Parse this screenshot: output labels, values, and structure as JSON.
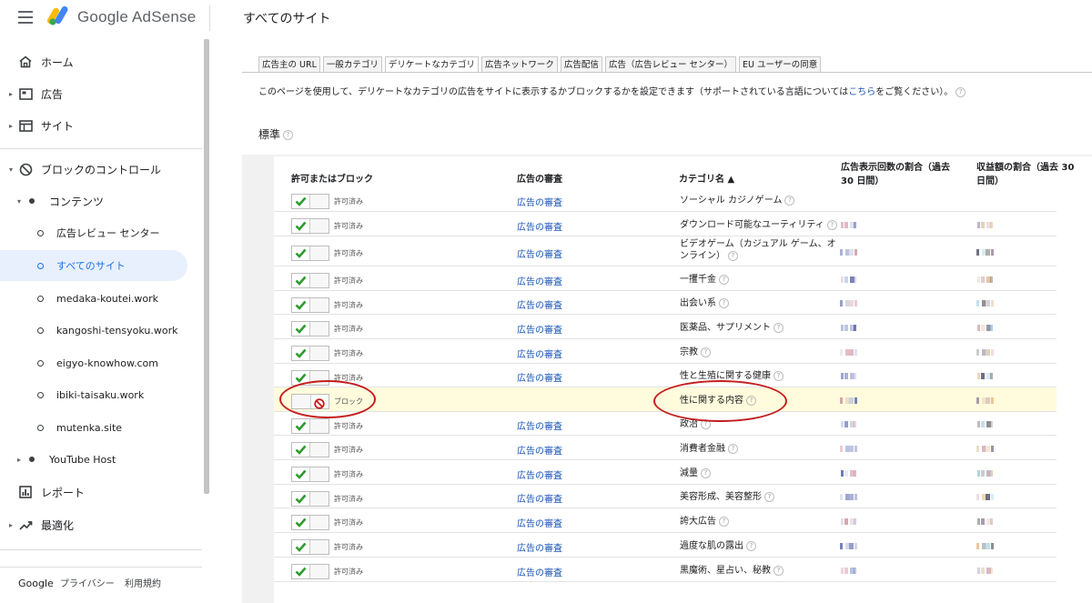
{
  "header": {
    "logo_text": "Google AdSense",
    "page_title": "すべてのサイト"
  },
  "sidebar": {
    "items": [
      {
        "label": "ホーム"
      },
      {
        "label": "広告"
      },
      {
        "label": "サイト"
      },
      {
        "label": "ブロックのコントロール"
      },
      {
        "label": "コンテンツ"
      },
      {
        "label": "広告レビュー センター"
      },
      {
        "label": "すべてのサイト"
      },
      {
        "label": "medaka-koutei.work"
      },
      {
        "label": "kangoshi-tensyoku.work"
      },
      {
        "label": "eigyo-knowhow.com"
      },
      {
        "label": "ibiki-taisaku.work"
      },
      {
        "label": "mutenka.site"
      },
      {
        "label": "YouTube Host"
      },
      {
        "label": "レポート"
      },
      {
        "label": "最適化"
      }
    ],
    "footer": {
      "google": "Google",
      "privacy": "プライバシー",
      "terms": "利用規約"
    }
  },
  "tabs": [
    "広告主の URL",
    "一般カテゴリ",
    "デリケートなカテゴリ",
    "広告ネットワーク",
    "広告配信",
    "広告（広告レビュー センター）",
    "EU ユーザーの同意"
  ],
  "description": {
    "before": "このページを使用して、デリケートなカテゴリの広告をサイトに表示するかブロックするかを設定できます（サポートされている言語については",
    "link": "こちら",
    "after": "をご覧ください）。"
  },
  "section_title": "標準",
  "help_glyph": "?",
  "table": {
    "headers": {
      "allow_block": "許可またはブロック",
      "review": "広告の審査",
      "category": "カテゴリ名 ▲",
      "impressions": "広告表示回数の割合（過去 30 日間）",
      "earnings": "収益額の割合（過去 30 日間）"
    },
    "rows": [
      {
        "state": "許可済み",
        "blocked": false,
        "review": "広告の審査",
        "category": "ソーシャル カジノゲーム"
      },
      {
        "state": "許可済み",
        "blocked": false,
        "review": "広告の審査",
        "category": "ダウンロード可能なユーティリティ"
      },
      {
        "state": "許可済み",
        "blocked": false,
        "review": "広告の審査",
        "category": "ビデオゲーム（カジュアル ゲーム、オンライン）"
      },
      {
        "state": "許可済み",
        "blocked": false,
        "review": "広告の審査",
        "category": "一攫千金"
      },
      {
        "state": "許可済み",
        "blocked": false,
        "review": "広告の審査",
        "category": "出会い系"
      },
      {
        "state": "許可済み",
        "blocked": false,
        "review": "広告の審査",
        "category": "医薬品、サプリメント"
      },
      {
        "state": "許可済み",
        "blocked": false,
        "review": "広告の審査",
        "category": "宗教"
      },
      {
        "state": "許可済み",
        "blocked": false,
        "review": "広告の審査",
        "category": "性と生殖に関する健康"
      },
      {
        "state": "ブロック",
        "blocked": true,
        "review": "",
        "category": "性に関する内容"
      },
      {
        "state": "許可済み",
        "blocked": false,
        "review": "広告の審査",
        "category": "政治"
      },
      {
        "state": "許可済み",
        "blocked": false,
        "review": "広告の審査",
        "category": "消費者金融"
      },
      {
        "state": "許可済み",
        "blocked": false,
        "review": "広告の審査",
        "category": "減量"
      },
      {
        "state": "許可済み",
        "blocked": false,
        "review": "広告の審査",
        "category": "美容形成、美容整形"
      },
      {
        "state": "許可済み",
        "blocked": false,
        "review": "広告の審査",
        "category": "誇大広告"
      },
      {
        "state": "許可済み",
        "blocked": false,
        "review": "広告の審査",
        "category": "過度な肌の露出"
      },
      {
        "state": "許可済み",
        "blocked": false,
        "review": "広告の審査",
        "category": "黒魔術、星占い、秘教"
      }
    ]
  },
  "colors": {
    "accent": "#1a73e8",
    "link": "#1a55b5",
    "check": "#2e9b2e",
    "block": "#c41e1e",
    "blocked_row": "#fffbdc"
  }
}
